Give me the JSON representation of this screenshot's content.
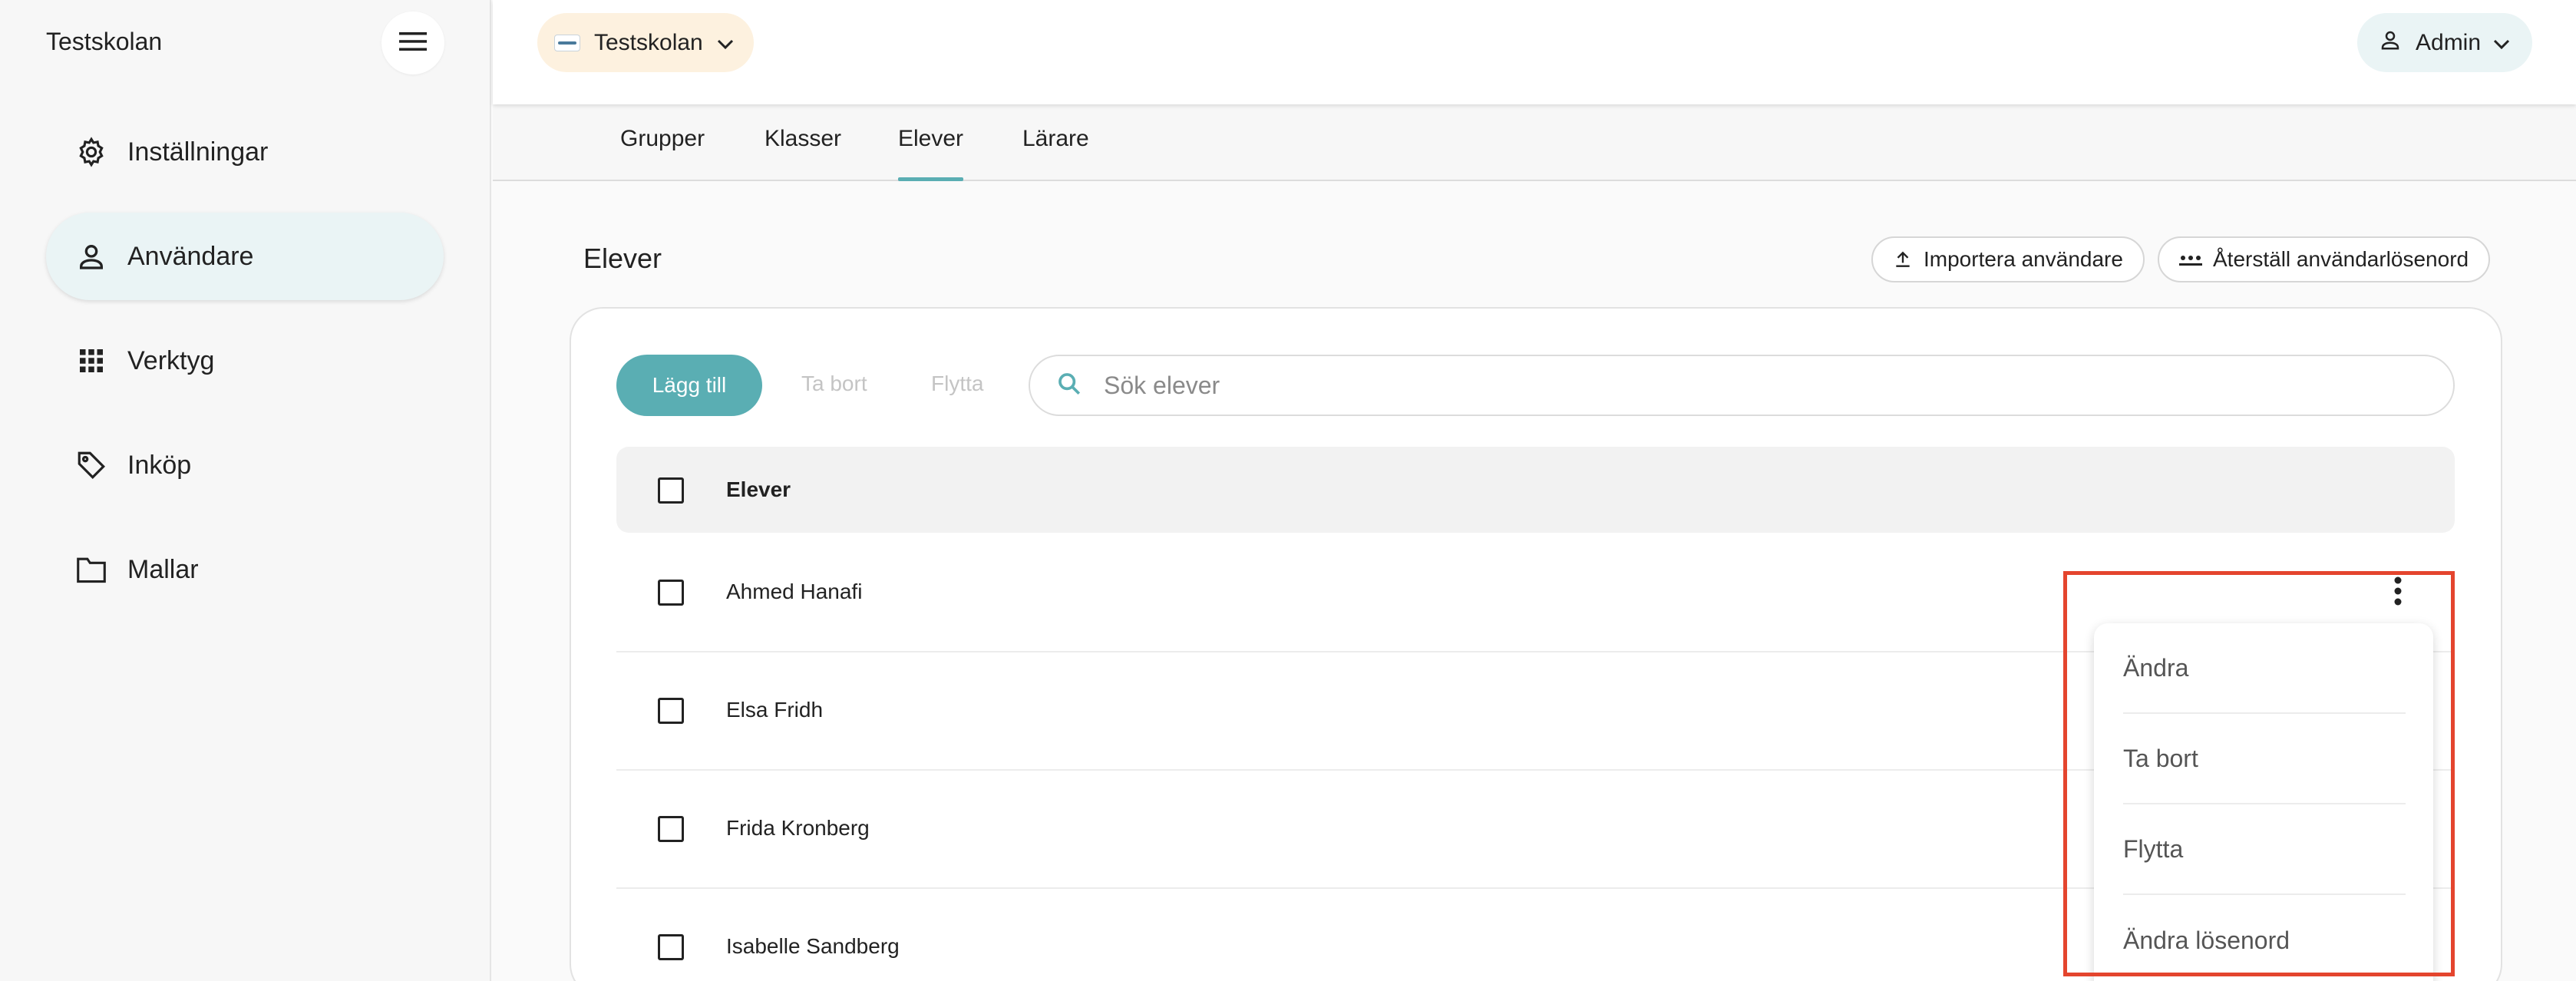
{
  "sidebar": {
    "brand": "Testskolan",
    "items": [
      {
        "label": "Inställningar",
        "icon": "gear-icon"
      },
      {
        "label": "Användare",
        "icon": "user-icon",
        "active": true
      },
      {
        "label": "Verktyg",
        "icon": "grid-icon"
      },
      {
        "label": "Inköp",
        "icon": "tag-icon"
      },
      {
        "label": "Mallar",
        "icon": "folder-icon"
      }
    ]
  },
  "topbar": {
    "school": "Testskolan",
    "user": "Admin"
  },
  "tabs": [
    {
      "label": "Grupper"
    },
    {
      "label": "Klasser"
    },
    {
      "label": "Elever",
      "active": true
    },
    {
      "label": "Lärare"
    }
  ],
  "main": {
    "title": "Elever",
    "import_label": "Importera användare",
    "reset_label": "Återställ användarlösenord",
    "add_label": "Lägg till",
    "remove_label": "Ta bort",
    "move_label": "Flytta",
    "search_placeholder": "Sök elever",
    "column_header": "Elever",
    "rows": [
      "Ahmed Hanafi",
      "Elsa Fridh",
      "Frida Kronberg",
      "Isabelle Sandberg"
    ]
  },
  "context_menu": {
    "items": [
      "Ändra",
      "Ta bort",
      "Flytta",
      "Ändra lösenord"
    ]
  },
  "colors": {
    "accent": "#5aaeb3",
    "highlight": "#e4452e",
    "active_nav_bg": "#eaf4f5",
    "school_pill_bg": "#fdf1df"
  }
}
